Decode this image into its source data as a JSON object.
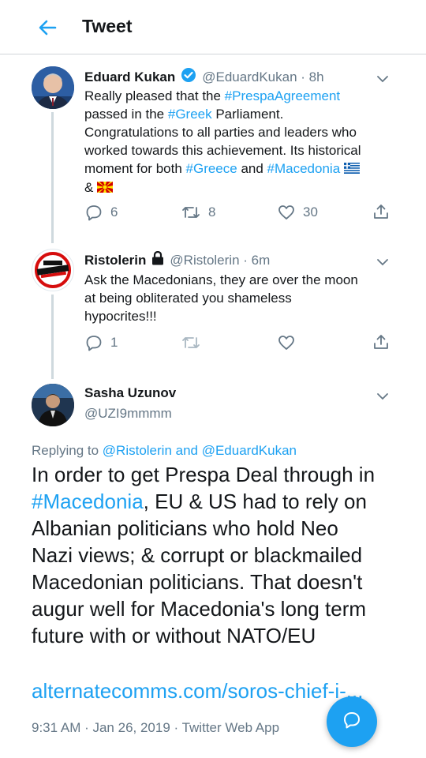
{
  "header": {
    "title": "Tweet"
  },
  "tweet1": {
    "name": "Eduard Kukan",
    "handle_time": "@EduardKukan · 8h",
    "text": {
      "p1": "Really pleased that the ",
      "h1": "#PrespaAgreement",
      "p2": "passed in the ",
      "h2": "#Greek",
      "p3": " Parliament.",
      "line3": "Congratulations to all parties and leaders who",
      "line4": "worked towards this achievement. Its historical",
      "p5": "moment for both ",
      "h3": "#Greece",
      "p6": " and ",
      "h4": "#Macedonia",
      "p7": "&"
    },
    "replies": "6",
    "retweets": "8",
    "likes": "30"
  },
  "tweet2": {
    "name": "Ristolerin",
    "handle_time": "@Ristolerin · 6m",
    "line1": "Ask the Macedonians, they are over the moon",
    "line2": "at being obliterated you shameless",
    "line3": "hypocrites!!!",
    "replies": "1"
  },
  "tweet3": {
    "name": "Sasha Uzunov",
    "handle": "@UZI9mmmm",
    "replying_prefix": "Replying to ",
    "replying_to": "@Ristolerin and @EduardKukan",
    "line1": "In order to get Prespa Deal through in",
    "hashtag": "#Macedonia",
    "line2_rest": ", EU & US had to rely on",
    "line3": "Albanian politicians who hold Neo",
    "line4": "Nazi views; & corrupt or blackmailed",
    "line5": "Macedonian politicians. That doesn't",
    "line6": "augur well for Macedonia's long term",
    "line7": "future with or without NATO/EU",
    "link": "alternatecomms.com/soros-chief-i-...",
    "timestamp": "9:31 AM · Jan 26, 2019 · Twitter Web App"
  },
  "colors": {
    "accent": "#1da1f2",
    "muted": "#657786",
    "text": "#14171a"
  }
}
